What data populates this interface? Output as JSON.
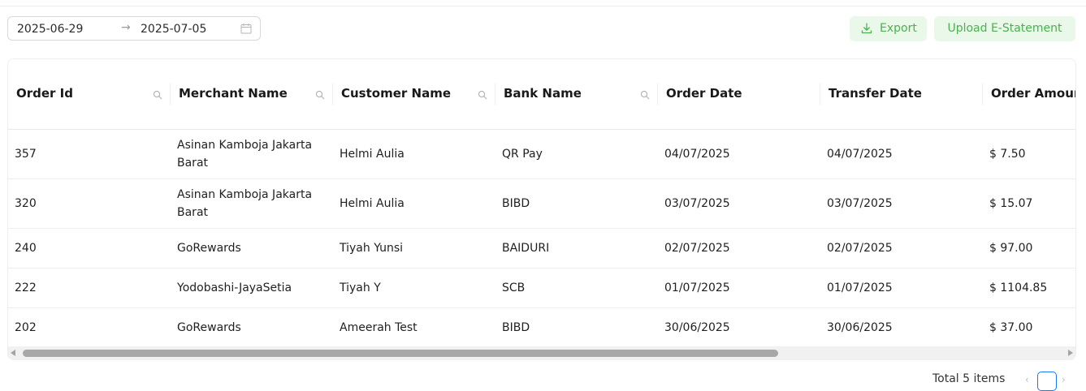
{
  "toolbar": {
    "date_start": "2025-06-29",
    "date_separator": "→",
    "date_end": "2025-07-05",
    "calendar_icon": "calendar-icon",
    "export_label": "Export",
    "export_icon": "download-icon",
    "upload_label": "Upload E-Statement",
    "accent_color": "#4caf50",
    "button_bg": "#eaf8ea"
  },
  "table": {
    "columns": [
      {
        "label": "Order Id",
        "searchable": true
      },
      {
        "label": "Merchant Name",
        "searchable": true
      },
      {
        "label": "Customer Name",
        "searchable": true
      },
      {
        "label": "Bank Name",
        "searchable": true
      },
      {
        "label": "Order Date",
        "searchable": false
      },
      {
        "label": "Transfer Date",
        "searchable": false
      },
      {
        "label": "Order Amount",
        "searchable": false
      }
    ],
    "rows": [
      {
        "order_id": "357",
        "merchant": "Asinan Kamboja Jakarta Barat",
        "customer": "Helmi Aulia",
        "bank": "QR Pay",
        "order_date": "04/07/2025",
        "transfer_date": "04/07/2025",
        "amount": "$ 7.50"
      },
      {
        "order_id": "320",
        "merchant": "Asinan Kamboja Jakarta Barat",
        "customer": "Helmi Aulia",
        "bank": "BIBD",
        "order_date": "03/07/2025",
        "transfer_date": "03/07/2025",
        "amount": "$ 15.07"
      },
      {
        "order_id": "240",
        "merchant": "GoRewards",
        "customer": "Tiyah Yunsi",
        "bank": "BAIDURI",
        "order_date": "02/07/2025",
        "transfer_date": "02/07/2025",
        "amount": "$ 97.00"
      },
      {
        "order_id": "222",
        "merchant": "Yodobashi-JayaSetia",
        "customer": "Tiyah Y",
        "bank": "SCB",
        "order_date": "01/07/2025",
        "transfer_date": "01/07/2025",
        "amount": "$ 1104.85"
      },
      {
        "order_id": "202",
        "merchant": "GoRewards",
        "customer": "Ameerah Test",
        "bank": "BIBD",
        "order_date": "30/06/2025",
        "transfer_date": "30/06/2025",
        "amount": "$ 37.00"
      }
    ]
  },
  "footer": {
    "total_label": "Total 5 items",
    "current_page": "1"
  }
}
